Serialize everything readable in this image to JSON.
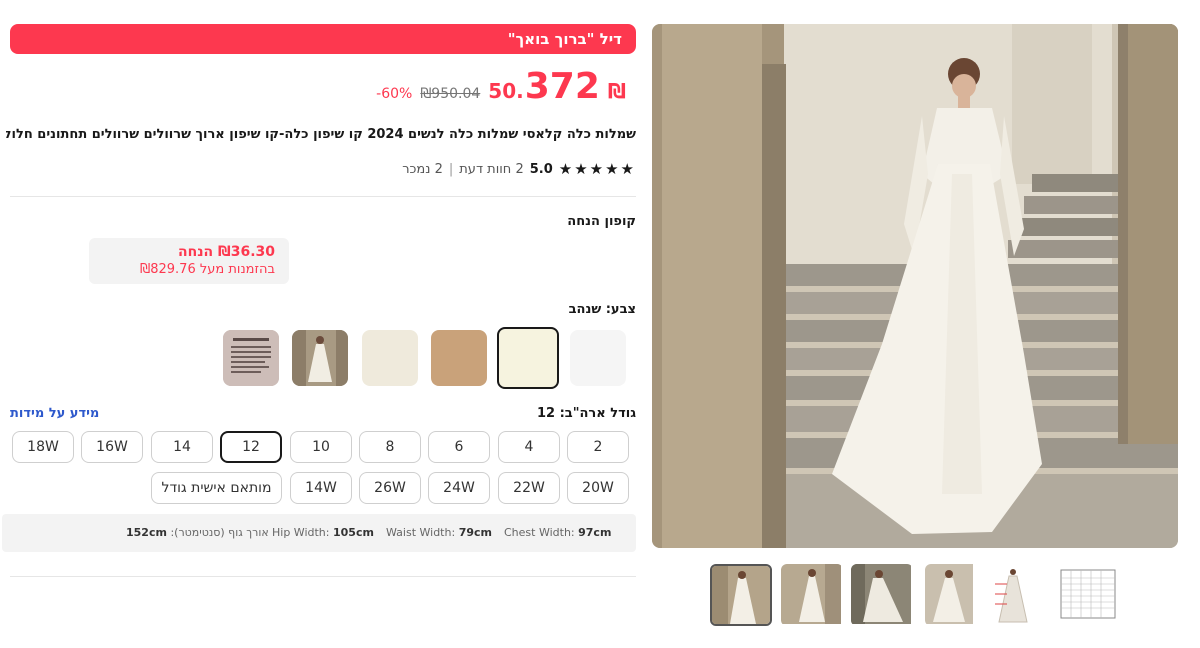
{
  "deal": {
    "banner": "דיל \"ברוך בואך\""
  },
  "price": {
    "currency": "₪",
    "integer": "372",
    "decimal": ".50",
    "original": "₪950.04",
    "discount": "60%-"
  },
  "product": {
    "title": "שמלות כלה קלאסי שמלות כלה לנשים 2024 קו שיפון כלה-קו שיפון ארוך שרוולים שרוולים תחתונים חלוקי גב"
  },
  "rating": {
    "stars": "★★★★★",
    "value": "5.0",
    "reviews": "2 חוות דעת",
    "sold": "2 נמכר",
    "separator": "|"
  },
  "coupon": {
    "title": "קופון הנחה",
    "amount": "₪36.30 הנחה",
    "condition": "בהזמנות מעל ₪829.76"
  },
  "color": {
    "label": "צבע: שנהב",
    "swatches": [
      {
        "name": "white",
        "color": "#f5f5f5"
      },
      {
        "name": "ivory",
        "color": "#f6f3df",
        "selected": true
      },
      {
        "name": "champagne",
        "color": "#c9a27a"
      },
      {
        "name": "cream",
        "color": "#efeadc"
      },
      {
        "name": "photo",
        "color": "#b4a287"
      },
      {
        "name": "custom-made",
        "color": "#cbbcb8"
      }
    ]
  },
  "size": {
    "label": "גודל ארה\"ב: 12",
    "info_link": "מידע על מידות",
    "row1": [
      "2",
      "4",
      "6",
      "8",
      "10",
      "12",
      "14",
      "16W",
      "18W"
    ],
    "row2": [
      "20W",
      "22W",
      "24W",
      "26W",
      "14W",
      "מותאם אישית גודל"
    ],
    "selected": "12"
  },
  "specs": {
    "chest_label": "Chest Width:",
    "chest_value": "97cm",
    "waist_label": "Waist Width:",
    "waist_value": "79cm",
    "hip_label": "Hip Width:",
    "hip_value": "105cm",
    "body_label": "אורך גוף (סנטימטר):",
    "body_value": "152cm"
  },
  "gallery": {
    "thumbnails": 6
  },
  "colors": {
    "accent": "#fd384f",
    "link": "#2e59cc"
  }
}
